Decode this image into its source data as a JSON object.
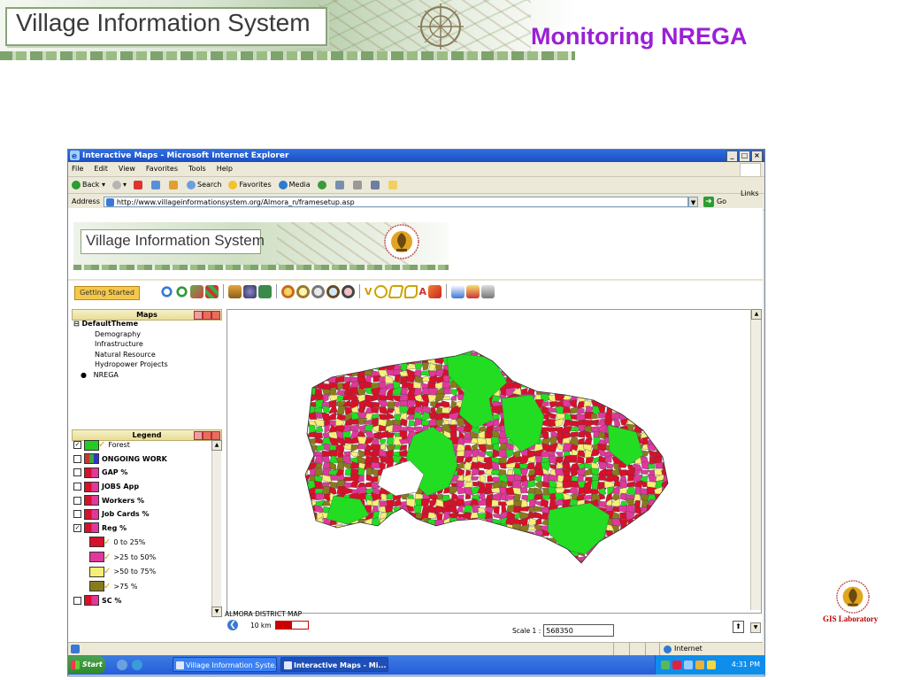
{
  "slide": {
    "banner_title": "Village Information System",
    "title": "Monitoring NREGA",
    "footer_logo_label": "GIS Laboratory"
  },
  "window": {
    "title": "Interactive Maps - Microsoft Internet Explorer",
    "buttons": {
      "minimize": "_",
      "maximize": "□",
      "close": "×"
    }
  },
  "menu": [
    "File",
    "Edit",
    "View",
    "Favorites",
    "Tools",
    "Help"
  ],
  "toolbar": {
    "back": "Back",
    "search": "Search",
    "favorites": "Favorites",
    "media": "Media"
  },
  "address": {
    "label": "Address",
    "url": "http://www.villageinformationsystem.org/Almora_n/framesetup.asp",
    "go": "Go",
    "links": "Links"
  },
  "page": {
    "banner_title": "Village Information System",
    "getting_started": "Getting Started"
  },
  "maps_panel": {
    "title": "Maps",
    "root": "DefaultTheme",
    "items": [
      "Demography",
      "Infrastructure",
      "Natural Resource",
      "Hydropower Projects"
    ],
    "selected": "NREGA"
  },
  "legend_panel": {
    "title": "Legend",
    "layers": [
      {
        "label": "Forest",
        "checked": true,
        "color": "#22cc22"
      },
      {
        "label": "ONGOING WORK",
        "checked": false
      },
      {
        "label": "GAP %",
        "checked": false
      },
      {
        "label": "JOBS App",
        "checked": false
      },
      {
        "label": "Workers %",
        "checked": false
      },
      {
        "label": "Job Cards %",
        "checked": false
      },
      {
        "label": "Reg %",
        "checked": true
      }
    ],
    "reg_classes": [
      {
        "label": "0 to 25%",
        "color": "#d8102a"
      },
      {
        "label": ">25 to 50%",
        "color": "#e0389c"
      },
      {
        "label": ">50 to 75%",
        "color": "#f6f078"
      },
      {
        "label": ">75 %",
        "color": "#8a7a1e"
      }
    ],
    "last_layer": {
      "label": "SC %",
      "checked": false
    }
  },
  "map": {
    "caption": "ALMORA DISTRICT MAP",
    "scale_bar_label": "10 km",
    "scale_label": "Scale  1 :",
    "scale_value": "568350",
    "colors": {
      "forest": "#22dd22",
      "low": "#d8102a",
      "mid": "#e0389c",
      "high": "#f6f078",
      "top": "#8a7a1e"
    }
  },
  "statusbar": {
    "zone": "Internet"
  },
  "taskbar": {
    "start": "Start",
    "tasks": [
      "Village Information Syste...",
      "Interactive Maps - Mi..."
    ],
    "clock": "4:31 PM"
  }
}
